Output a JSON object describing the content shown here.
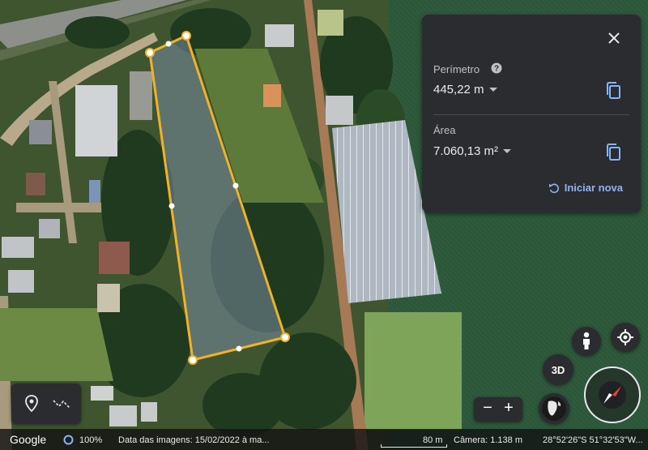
{
  "measure_panel": {
    "perimeter_label": "Perímetro",
    "perimeter_value": "445,22 m",
    "area_label": "Área",
    "area_value": "7.060,13 m²",
    "restart_label": "Iniciar nova"
  },
  "controls": {
    "view_3d_label": "3D",
    "zoom_out_label": "−",
    "zoom_in_label": "+"
  },
  "footer": {
    "brand": "Google",
    "zoom": "100%",
    "imagery_date": "Data das imagens: 15/02/2022 à ma...",
    "scale": "80 m",
    "camera": "Câmera: 1.138 m",
    "coordinates": "28°52'26\"S 51°32'53\"W..."
  },
  "colors": {
    "polygon": "#f1b22b",
    "accent": "#8ab4f8",
    "panel": "#2b2c2f"
  }
}
